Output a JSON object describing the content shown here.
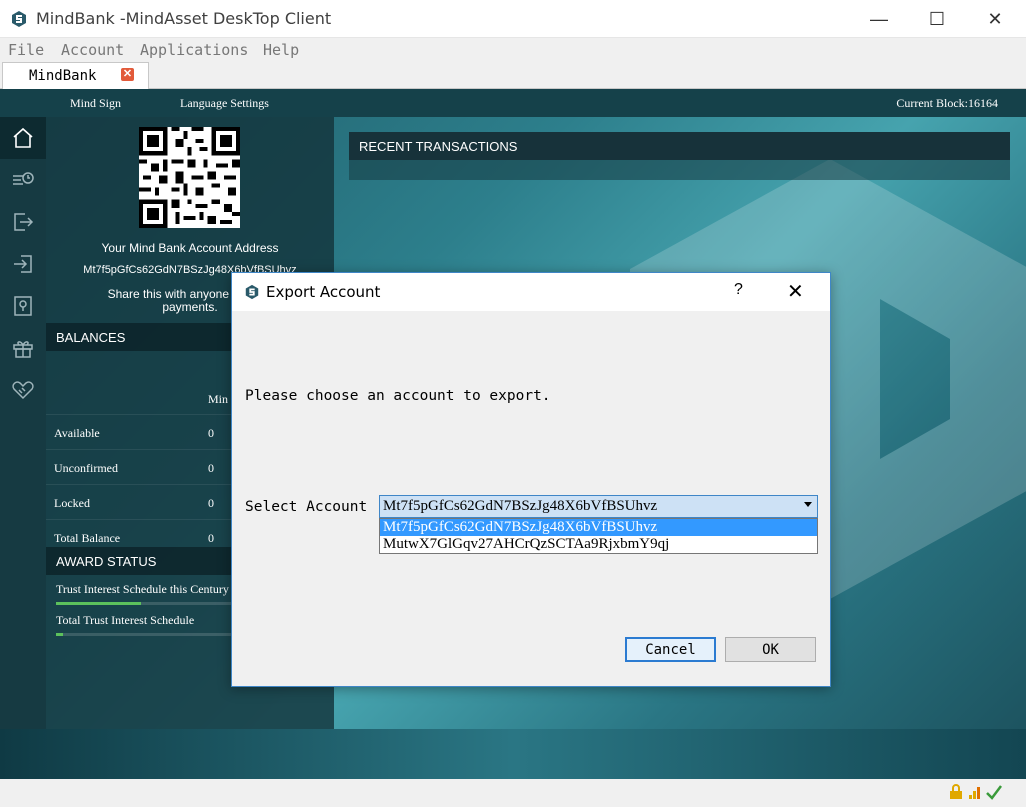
{
  "window": {
    "title": "MindBank -MindAsset DeskTop Client",
    "controls": {
      "minimize": "—",
      "maximize": "☐",
      "close": "✕"
    }
  },
  "menu": {
    "file": "File",
    "account": "Account",
    "applications": "Applications",
    "help": "Help"
  },
  "tabs": [
    {
      "label": "MindBank",
      "close": "✕"
    }
  ],
  "topnav": {
    "mind_sign": "Mind Sign",
    "language_settings": "Language Settings",
    "current_block": "Current Block:16164"
  },
  "sidebar_icons": [
    "home-icon",
    "transfer-time-icon",
    "send-icon",
    "receive-icon",
    "location-icon",
    "gift-icon",
    "heart-handshake-icon"
  ],
  "account_panel": {
    "address_title": "Your Mind Bank Account Address",
    "address": "Mt7f5pGfCs62GdN7BSzJg48X6bVfBSUhvz",
    "share_text_line1": "Share this with anyone and the",
    "share_text_line2": "payments."
  },
  "balances": {
    "header": "BALANCES",
    "column": "Min",
    "rows": [
      {
        "label": "Available",
        "value": "0"
      },
      {
        "label": "Unconfirmed",
        "value": "0"
      },
      {
        "label": "Locked",
        "value": "0"
      },
      {
        "label": "Total Balance",
        "value": "0"
      }
    ]
  },
  "award_status": {
    "header": "AWARD STATUS",
    "items": [
      {
        "label": "Trust Interest Schedule this Century",
        "progress": 0.47
      },
      {
        "label": "Total Trust Interest Schedule",
        "progress": 0.04
      }
    ]
  },
  "recent": {
    "header": "RECENT TRANSACTIONS"
  },
  "dialog": {
    "title": "Export Account",
    "help": "?",
    "close": "✕",
    "prompt": "Please choose an account to export.",
    "select_label": "Select Account",
    "selected_value": "Mt7f5pGfCs62GdN7BSzJg48X6bVfBSUhvz",
    "options": [
      "Mt7f5pGfCs62GdN7BSzJg48X6bVfBSUhvz",
      "MutwX7GlGqv27AHCrQzSCTAa9RjxbmY9qj"
    ],
    "cancel": "Cancel",
    "ok": "OK"
  },
  "colors": {
    "accent": "#3f86c7",
    "selection": "#3399ff",
    "panel": "#163a42",
    "progress": "#5cc15c"
  }
}
